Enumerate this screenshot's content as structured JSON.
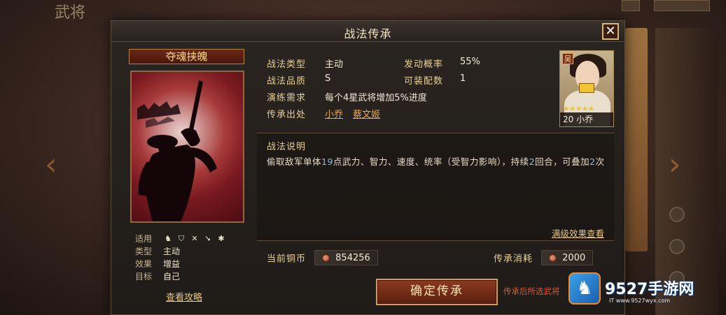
{
  "background": {
    "top_title": "武将",
    "arrow_left": "‹",
    "arrow_right": "›"
  },
  "dialog": {
    "title": "战法传承",
    "close_icon": "close-icon",
    "close_glyph": "✕"
  },
  "skill": {
    "name": "夺魂挟魄",
    "attributes": [
      {
        "label": "适用",
        "value": ""
      },
      {
        "label": "类型",
        "value": "主动"
      },
      {
        "label": "效果",
        "value": "增益"
      },
      {
        "label": "目标",
        "value": "自己"
      }
    ],
    "troop_icons": [
      "cavalry-icon",
      "shield-icon",
      "bow-icon",
      "spear-icon",
      "siege-icon"
    ],
    "troop_glyphs": [
      "♞",
      "⛉",
      "✕",
      "➘",
      "✱"
    ],
    "guide_link": "查看攻略"
  },
  "info": {
    "type_label": "战法类型",
    "type_value": "主动",
    "rate_label": "发动概率",
    "rate_value": "55%",
    "quality_label": "战法品质",
    "quality_value": "S",
    "slots_label": "可装配数",
    "slots_value": "1",
    "practice_label": "演练需求",
    "practice_value": "每个4星武将增加5%进度",
    "source_label": "传承出处",
    "source_heroes": [
      "小乔",
      "蔡文姬"
    ]
  },
  "portrait": {
    "faction": "吴",
    "stars": "★★★★★",
    "level_name": "20 小乔"
  },
  "description": {
    "title": "战法说明",
    "text_before": "偷取敌军单体",
    "highlight1": "19",
    "text_middle": "点武力、智力、速度、统率（受智力影响），持续",
    "highlight2": "2",
    "text_middle2": "回合，可叠加",
    "highlight3": "2",
    "text_after": "次",
    "full_effect_link": "满级效果查看"
  },
  "costs": {
    "copper_label": "当前铜币",
    "copper_value": "854256",
    "inherit_label": "传承消耗",
    "inherit_value": "2000"
  },
  "actions": {
    "confirm_label": "确定传承",
    "hint": "传承后所选武将"
  },
  "watermark": {
    "brand": "9527手游网",
    "url": "IT www.9527wyx.com"
  },
  "colors": {
    "accent_gold": "#e7cf94",
    "link_orange": "#e9a85c",
    "highlight_blue": "#7fc0e8",
    "warning_red": "#d85a3a"
  }
}
